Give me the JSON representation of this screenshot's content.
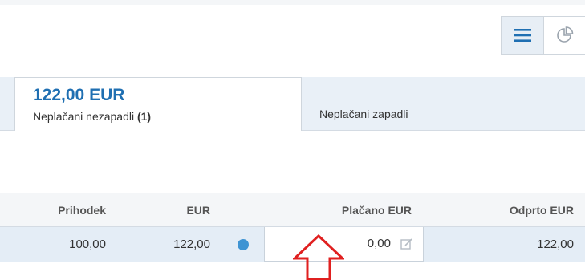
{
  "view_toggle": {
    "list_icon": "hamburger-list-icon",
    "chart_icon": "pie-chart-icon"
  },
  "tabs": [
    {
      "amount": "122,00 EUR",
      "label": "Neplačani nezapadli ",
      "count": "(1)",
      "active": true
    },
    {
      "label": "Neplačani zapadli",
      "active": false
    }
  ],
  "table": {
    "headers": {
      "income": "Prihodek",
      "eur": "EUR",
      "paid": "Plačano EUR",
      "open": "Odprto EUR"
    },
    "row": {
      "income": "100,00",
      "eur": "122,00",
      "status_color": "#3f94d3",
      "paid": "0,00",
      "open": "122,00"
    }
  },
  "annotation": {
    "arrow_color": "#e02020",
    "icon": "up-arrow-outline-icon"
  }
}
